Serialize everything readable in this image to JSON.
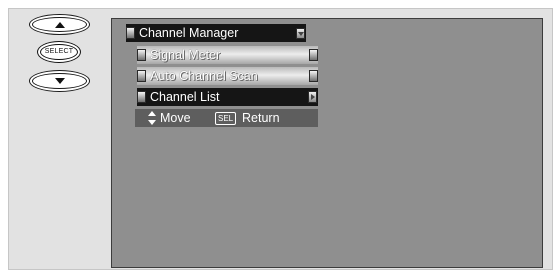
{
  "remote": {
    "up_icon": "arrow-up-icon",
    "select_label": "SELECT",
    "down_icon": "arrow-down-icon"
  },
  "menu": {
    "title": "Channel Manager",
    "items": [
      {
        "label": "Signal Meter",
        "style": "light"
      },
      {
        "label": "Auto Channel Scan",
        "style": "light"
      },
      {
        "label": "Channel List",
        "style": "dark",
        "selected": true
      }
    ]
  },
  "help": {
    "move_label": "Move",
    "sel_key": "SEL",
    "return_label": "Return"
  }
}
